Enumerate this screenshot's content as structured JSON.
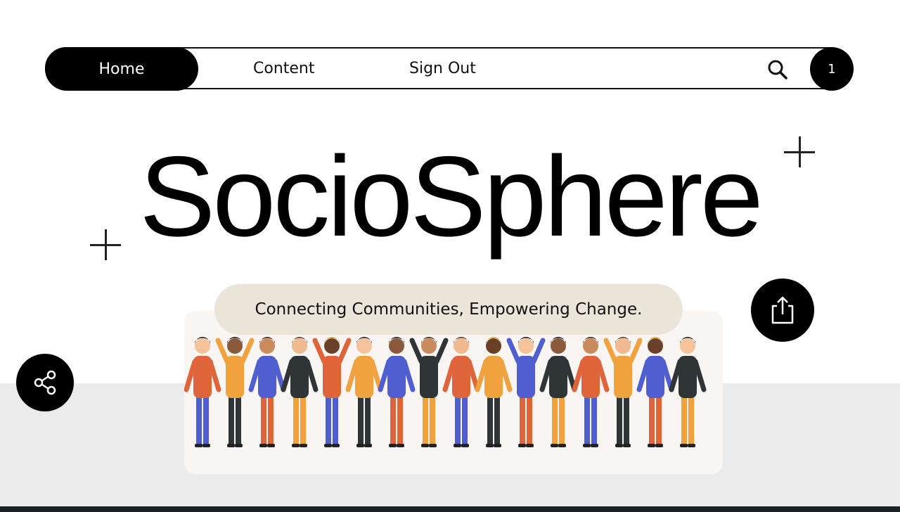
{
  "nav": {
    "home_label": "Home",
    "content_label": "Content",
    "signout_label": "Sign Out",
    "search_icon": "search-icon",
    "notification_count": "1"
  },
  "hero": {
    "title": "SocioSphere",
    "tagline": "Connecting Communities, Empowering Change."
  },
  "actions": {
    "upload_icon": "share-upload-icon",
    "share_icon": "share-nodes-icon"
  },
  "illustration": {
    "subject": "group-of-diverse-people-holding-hands",
    "palette": [
      "#e0643a",
      "#f0a23e",
      "#4f5fd0",
      "#2f3437",
      "#f4c39b",
      "#8b5a3c"
    ]
  },
  "colors": {
    "primary": "#000000",
    "pill_bg": "#eae4d9",
    "card_bg": "#f8f5f2",
    "band_bg": "#ebebeb"
  }
}
